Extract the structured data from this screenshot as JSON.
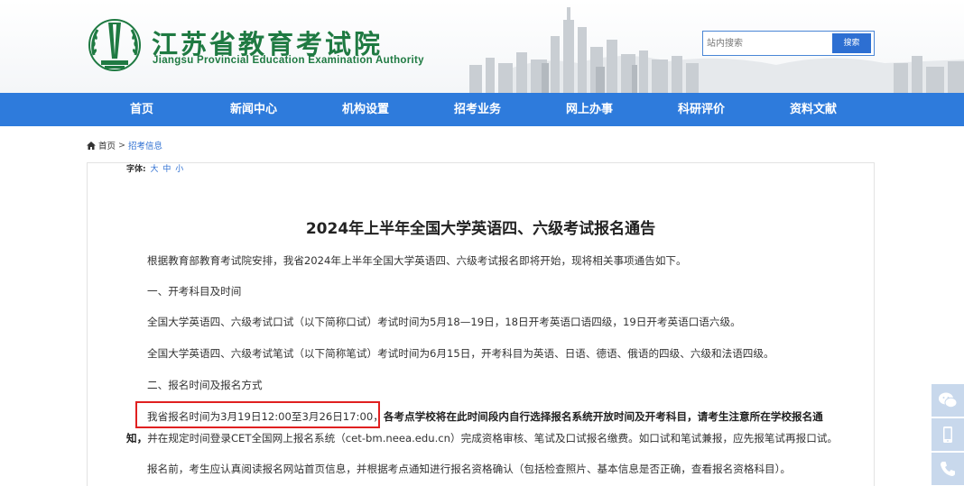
{
  "header": {
    "logo_cn": "江苏省教育考试院",
    "logo_en": "Jiangsu Provincial Education Examination Authority",
    "search_placeholder": "站内搜索",
    "search_button": "搜索"
  },
  "nav": {
    "items": [
      "首页",
      "新闻中心",
      "机构设置",
      "招考业务",
      "网上办事",
      "科研评价",
      "资料文献"
    ]
  },
  "breadcrumb": {
    "home": "首页",
    "separator": ">",
    "current": "招考信息"
  },
  "article": {
    "font_size_label": "字体:",
    "font_size_options": [
      "大",
      "中",
      "小"
    ],
    "title": "2024年上半年全国大学英语四、六级考试报名通告",
    "intro": "根据教育部教育考试院安排，我省2024年上半年全国大学英语四、六级考试报名即将开始，现将相关事项通告如下。",
    "section1": "一、开考科目及时间",
    "oral": "全国大学英语四、六级考试口试（以下简称口试）考试时间为5月18—19日，18日开考英语口语四级，19日开考英语口语六级。",
    "written": "全国大学英语四、六级考试笔试（以下简称笔试）考试时间为6月15日，开考科目为英语、日语、德语、俄语的四级、六级和法语四级。",
    "section2": "二、报名时间及报名方式",
    "reg_time": "我省报名时间为3月19日12:00至3月26日17:00，",
    "reg_bold_1": "各考点学校将在此时间段内自行选择报名系统开放时间及开考科目，请考生注意所在学校报名通",
    "reg_bold_2": "知，",
    "reg_rest": "并在规定时间登录CET全国网上报名系统（cet-bm.neea.edu.cn）完成资格审核、笔试及口试报名缴费。如口试和笔试兼报，应先报笔试再报口试。",
    "before_reg": "报名前，考生应认真阅读报名网站首页信息，并根据考点通知进行报名资格确认（包括检查照片、基本信息是否正确，查看报名资格科目）。"
  },
  "side_tools": {
    "icons": [
      "wechat-icon",
      "mobile-icon",
      "phone-icon"
    ]
  },
  "colors": {
    "nav_blue": "#2e7bdc",
    "logo_green": "#1f7a42",
    "highlight_red": "#e02020"
  }
}
